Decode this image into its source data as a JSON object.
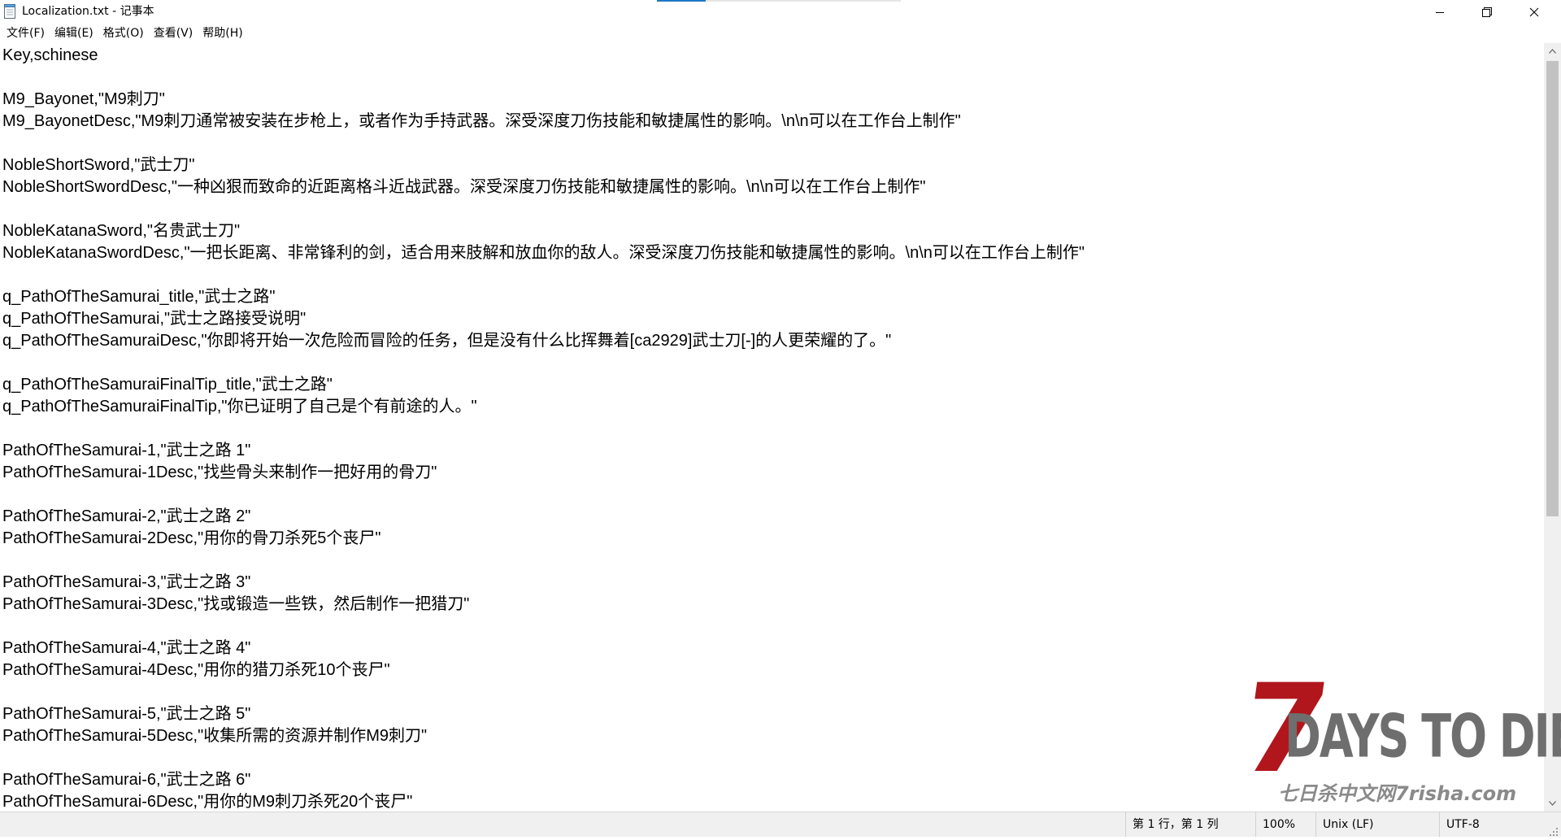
{
  "window": {
    "title": "Localization.txt - 记事本"
  },
  "menu": {
    "items": [
      "文件(F)",
      "编辑(E)",
      "格式(O)",
      "查看(V)",
      "帮助(H)"
    ]
  },
  "editor": {
    "lines": [
      "Key,schinese",
      "",
      "M9_Bayonet,\"M9刺刀\"",
      "M9_BayonetDesc,\"M9刺刀通常被安装在步枪上，或者作为手持武器。深受深度刀伤技能和敏捷属性的影响。\\n\\n可以在工作台上制作\"",
      "",
      "NobleShortSword,\"武士刀\"",
      "NobleShortSwordDesc,\"一种凶狠而致命的近距离格斗近战武器。深受深度刀伤技能和敏捷属性的影响。\\n\\n可以在工作台上制作\"",
      "",
      "NobleKatanaSword,\"名贵武士刀\"",
      "NobleKatanaSwordDesc,\"一把长距离、非常锋利的剑，适合用来肢解和放血你的敌人。深受深度刀伤技能和敏捷属性的影响。\\n\\n可以在工作台上制作\"",
      "",
      "q_PathOfTheSamurai_title,\"武士之路\"",
      "q_PathOfTheSamurai,\"武士之路接受说明\"",
      "q_PathOfTheSamuraiDesc,\"你即将开始一次危险而冒险的任务，但是没有什么比挥舞着[ca2929]武士刀[-]的人更荣耀的了。\"",
      "",
      "q_PathOfTheSamuraiFinalTip_title,\"武士之路\"",
      "q_PathOfTheSamuraiFinalTip,\"你已证明了自己是个有前途的人。\"",
      "",
      "PathOfTheSamurai-1,\"武士之路 1\"",
      "PathOfTheSamurai-1Desc,\"找些骨头来制作一把好用的骨刀\"",
      "",
      "PathOfTheSamurai-2,\"武士之路 2\"",
      "PathOfTheSamurai-2Desc,\"用你的骨刀杀死5个丧尸\"",
      "",
      "PathOfTheSamurai-3,\"武士之路 3\"",
      "PathOfTheSamurai-3Desc,\"找或锻造一些铁，然后制作一把猎刀\"",
      "",
      "PathOfTheSamurai-4,\"武士之路 4\"",
      "PathOfTheSamurai-4Desc,\"用你的猎刀杀死10个丧尸\"",
      "",
      "PathOfTheSamurai-5,\"武士之路 5\"",
      "PathOfTheSamurai-5Desc,\"收集所需的资源并制作M9刺刀\"",
      "",
      "PathOfTheSamurai-6,\"武士之路 6\"",
      "PathOfTheSamurai-6Desc,\"用你的M9刺刀杀死20个丧尸\""
    ]
  },
  "status": {
    "position": "第 1 行，第 1 列",
    "zoom": "100%",
    "line_ending": "Unix (LF)",
    "encoding": "UTF-8"
  },
  "watermark": {
    "brand": "DAYS TO DIE",
    "numeral": "7",
    "site": "七日杀中文网7risha.com"
  },
  "icons": {
    "app": "notepad-icon",
    "minimize": "minimize-icon",
    "maximize": "restore-icon",
    "close": "close-icon"
  },
  "colors": {
    "accent": "#1e78c8",
    "watermark_red": "#b0161c",
    "watermark_gray": "#6e6e6e"
  }
}
